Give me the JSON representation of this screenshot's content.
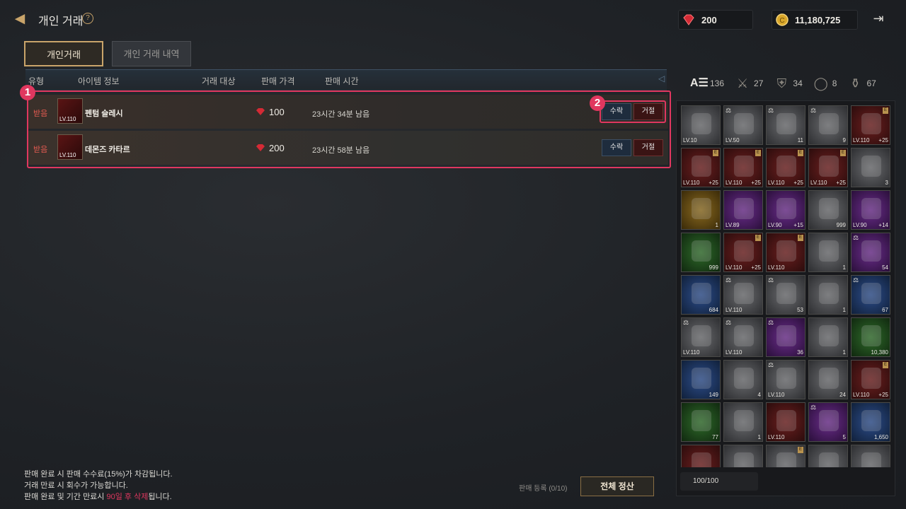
{
  "header": {
    "title": "개인 거래",
    "help": "?"
  },
  "currency": {
    "gems": "200",
    "gold": "11,180,725"
  },
  "tabs": [
    {
      "label": "개인거래"
    },
    {
      "label": "개인 거래 내역"
    }
  ],
  "table": {
    "columns": [
      "유형",
      "아이템 정보",
      "거래 대상",
      "판매 가격",
      "판매 시간"
    ],
    "rows": [
      {
        "type": "받음",
        "level": "LV.110",
        "name": "펜텀 슬레시",
        "price": "100",
        "time": "23시간 34분 남음",
        "accept": "수락",
        "reject": "거절"
      },
      {
        "type": "받음",
        "level": "LV.110",
        "name": "데몬즈 카타르",
        "price": "200",
        "time": "23시간 58분 남음",
        "accept": "수락",
        "reject": "거절"
      }
    ]
  },
  "annotations": {
    "badge1": "1",
    "badge2": "2"
  },
  "footer": {
    "note1": "판매 완료 시 판매 수수료(15%)가 차감됩니다.",
    "note2": "거래 만료 시 회수가 가능합니다.",
    "note3_a": "판매 완료 및 기간 만료시 ",
    "note3_b": "90일 후 삭제",
    "note3_c": "됩니다.",
    "register": "판매 등록 (0/10)",
    "settle_all": "전체 정산"
  },
  "inventory": {
    "categories": [
      {
        "icon": "all-items-icon",
        "label": "A☰",
        "count": "136"
      },
      {
        "icon": "weapon-icon",
        "label": "⚔",
        "count": "27"
      },
      {
        "icon": "armor-icon",
        "label": "⛨",
        "count": "34"
      },
      {
        "icon": "ring-icon",
        "label": "◯",
        "count": "8"
      },
      {
        "icon": "bag-icon",
        "label": "⚱",
        "count": "67"
      }
    ],
    "capacity": "100/100",
    "slots": [
      {
        "c": "g-gray",
        "lvl": "LV.10",
        "cnt": "",
        "mark": false,
        "scale": false
      },
      {
        "c": "g-gray",
        "lvl": "LV.50",
        "cnt": "",
        "mark": false,
        "scale": true
      },
      {
        "c": "g-gray",
        "lvl": "",
        "cnt": "11",
        "mark": false,
        "scale": true
      },
      {
        "c": "g-gray",
        "lvl": "",
        "cnt": "9",
        "mark": false,
        "scale": true
      },
      {
        "c": "g-red",
        "lvl": "LV.110",
        "cnt": "+25",
        "mark": true,
        "scale": false
      },
      {
        "c": "g-red",
        "lvl": "LV.110",
        "cnt": "+25",
        "mark": true,
        "scale": false
      },
      {
        "c": "g-red",
        "lvl": "LV.110",
        "cnt": "+25",
        "mark": true,
        "scale": false
      },
      {
        "c": "g-red",
        "lvl": "LV.110",
        "cnt": "+25",
        "mark": true,
        "scale": false
      },
      {
        "c": "g-red",
        "lvl": "LV.110",
        "cnt": "+25",
        "mark": true,
        "scale": false
      },
      {
        "c": "g-gray",
        "lvl": "",
        "cnt": "3",
        "mark": false,
        "scale": false
      },
      {
        "c": "g-gold",
        "lvl": "",
        "cnt": "1",
        "mark": false,
        "scale": false
      },
      {
        "c": "g-purple",
        "lvl": "LV.89",
        "cnt": "",
        "mark": false,
        "scale": false
      },
      {
        "c": "g-purple",
        "lvl": "LV.90",
        "cnt": "+15",
        "mark": false,
        "scale": false
      },
      {
        "c": "g-gray",
        "lvl": "",
        "cnt": "999",
        "mark": false,
        "scale": false
      },
      {
        "c": "g-purple",
        "lvl": "LV.90",
        "cnt": "+14",
        "mark": false,
        "scale": false
      },
      {
        "c": "g-green",
        "lvl": "",
        "cnt": "999",
        "mark": false,
        "scale": false
      },
      {
        "c": "g-red",
        "lvl": "LV.110",
        "cnt": "+25",
        "mark": true,
        "scale": false
      },
      {
        "c": "g-red",
        "lvl": "LV.110",
        "cnt": "",
        "mark": true,
        "scale": false
      },
      {
        "c": "g-gray",
        "lvl": "",
        "cnt": "1",
        "mark": false,
        "scale": false
      },
      {
        "c": "g-purple",
        "lvl": "",
        "cnt": "54",
        "mark": false,
        "scale": true
      },
      {
        "c": "g-blue",
        "lvl": "",
        "cnt": "684",
        "mark": false,
        "scale": false
      },
      {
        "c": "g-gray",
        "lvl": "LV.110",
        "cnt": "",
        "mark": false,
        "scale": true
      },
      {
        "c": "g-gray",
        "lvl": "",
        "cnt": "53",
        "mark": false,
        "scale": true
      },
      {
        "c": "g-gray",
        "lvl": "",
        "cnt": "1",
        "mark": false,
        "scale": false
      },
      {
        "c": "g-blue",
        "lvl": "",
        "cnt": "67",
        "mark": false,
        "scale": true
      },
      {
        "c": "g-gray",
        "lvl": "LV.110",
        "cnt": "",
        "mark": false,
        "scale": true
      },
      {
        "c": "g-gray",
        "lvl": "LV.110",
        "cnt": "",
        "mark": false,
        "scale": true
      },
      {
        "c": "g-purple",
        "lvl": "",
        "cnt": "36",
        "mark": false,
        "scale": true
      },
      {
        "c": "g-gray",
        "lvl": "",
        "cnt": "1",
        "mark": false,
        "scale": false
      },
      {
        "c": "g-green",
        "lvl": "",
        "cnt": "10,380",
        "mark": false,
        "scale": false
      },
      {
        "c": "g-blue",
        "lvl": "",
        "cnt": "149",
        "mark": false,
        "scale": false
      },
      {
        "c": "g-gray",
        "lvl": "",
        "cnt": "4",
        "mark": false,
        "scale": false
      },
      {
        "c": "g-gray",
        "lvl": "LV.110",
        "cnt": "",
        "mark": false,
        "scale": true
      },
      {
        "c": "g-gray",
        "lvl": "",
        "cnt": "24",
        "mark": false,
        "scale": false
      },
      {
        "c": "g-red",
        "lvl": "LV.110",
        "cnt": "+25",
        "mark": true,
        "scale": false
      },
      {
        "c": "g-green",
        "lvl": "",
        "cnt": "77",
        "mark": false,
        "scale": false
      },
      {
        "c": "g-gray",
        "lvl": "",
        "cnt": "1",
        "mark": false,
        "scale": false
      },
      {
        "c": "g-red",
        "lvl": "LV.110",
        "cnt": "",
        "mark": false,
        "scale": false
      },
      {
        "c": "g-purple",
        "lvl": "",
        "cnt": "5",
        "mark": false,
        "scale": true
      },
      {
        "c": "g-blue",
        "lvl": "",
        "cnt": "1,650",
        "mark": false,
        "scale": false
      },
      {
        "c": "g-red",
        "lvl": "",
        "cnt": "",
        "mark": false,
        "scale": false
      },
      {
        "c": "g-gray",
        "lvl": "",
        "cnt": "",
        "mark": false,
        "scale": false
      },
      {
        "c": "g-gray",
        "lvl": "",
        "cnt": "",
        "mark": true,
        "scale": false
      },
      {
        "c": "g-gray",
        "lvl": "",
        "cnt": "",
        "mark": false,
        "scale": false
      },
      {
        "c": "g-gray",
        "lvl": "",
        "cnt": "",
        "mark": false,
        "scale": false
      }
    ]
  },
  "colors": {
    "accent": "#c9a46a",
    "highlight": "#e0375f",
    "received": "#e05a50"
  }
}
